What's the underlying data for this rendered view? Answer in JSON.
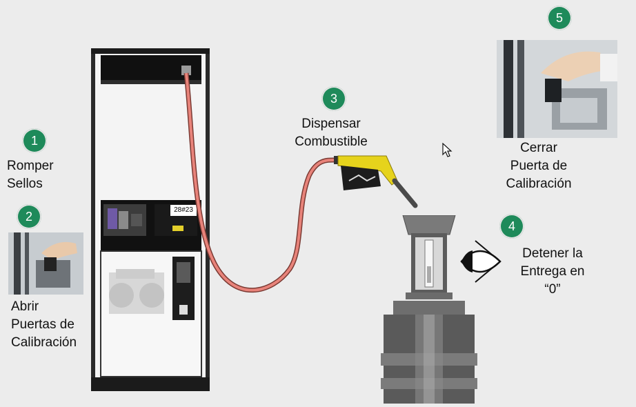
{
  "steps": [
    {
      "number": "1",
      "label_lines": [
        "Romper",
        "Sellos"
      ]
    },
    {
      "number": "2",
      "label_lines": [
        "Abrir",
        "Puertas de",
        "Calibración"
      ]
    },
    {
      "number": "3",
      "label_lines": [
        "Dispensar",
        "Combustible"
      ]
    },
    {
      "number": "4",
      "label_lines": [
        "Detener la",
        "Entrega en",
        "“0”"
      ]
    },
    {
      "number": "5",
      "label_lines": [
        "Cerrar",
        "Puerta de",
        "Calibración"
      ]
    }
  ],
  "dispenser": {
    "display_text": "28#23"
  },
  "colors": {
    "badge": "#1e8a5a",
    "hose": "#e8837a",
    "nozzle": "#e6d31c"
  },
  "icons": [
    "mouse-cursor-icon",
    "eye-icon"
  ]
}
